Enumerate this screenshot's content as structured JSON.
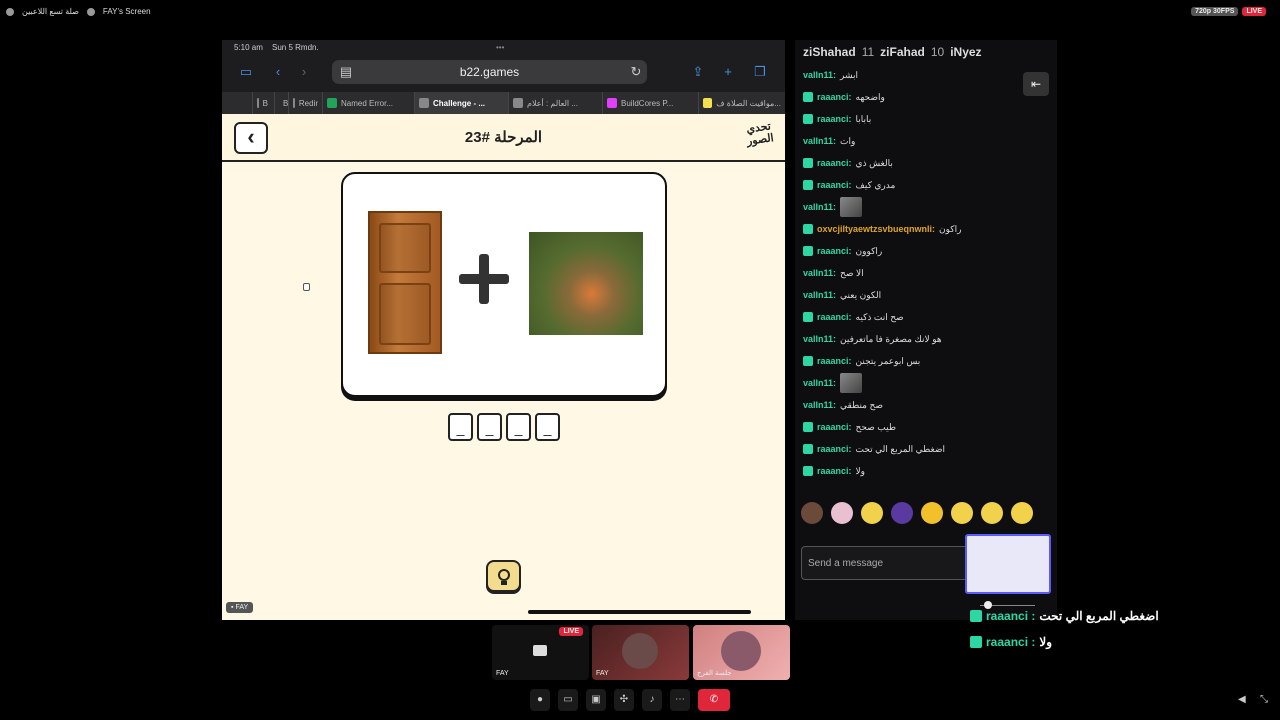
{
  "topbar": {
    "left_items": [
      "صلة تسع اللاعبين",
      "FAY's Screen"
    ],
    "quality": "720p 30FPS",
    "live": "LIVE"
  },
  "ipad": {
    "time": "5:10 am",
    "date": "Sun 5 Rmdn.",
    "url": "b22.games",
    "tabs": [
      {
        "label": "B",
        "color": "#888"
      },
      {
        "label": "B",
        "color": "#888"
      },
      {
        "label": "Redir",
        "color": "#888"
      },
      {
        "label": "Named Error...",
        "color": "#22a35a"
      },
      {
        "label": "Challenge - ...",
        "color": "#888"
      },
      {
        "label": "العالم : أعلام ...",
        "color": "#888"
      },
      {
        "label": "BuildCores P...",
        "color": "#e040fb"
      },
      {
        "label": "مواقيت الصلاة ف...",
        "color": "#f4e04d"
      }
    ],
    "level_title": "المرحلة #23",
    "logo_text": "تحدي الصور",
    "slots": [
      "_",
      "_",
      "_",
      "_"
    ],
    "fay_tag": "FAY"
  },
  "chat": {
    "viewers": [
      {
        "name": "ziShahad",
        "count": ""
      },
      {
        "name": "ziFahad",
        "count": "11"
      },
      {
        "name": "iNyez",
        "count": "10"
      }
    ],
    "messages": [
      {
        "user": "valln11:",
        "text": "ابشر",
        "color": "#2dd7a4",
        "badge": false
      },
      {
        "user": "raaanci:",
        "text": "واضحهه",
        "color": "#2dd7a4",
        "badge": true
      },
      {
        "user": "raaanci:",
        "text": "بابابا",
        "color": "#2dd7a4",
        "badge": true
      },
      {
        "user": "valln11:",
        "text": "وات",
        "color": "#2dd7a4",
        "badge": false
      },
      {
        "user": "raaanci:",
        "text": "بالغش ذي",
        "color": "#2dd7a4",
        "badge": true
      },
      {
        "user": "raaanci:",
        "text": "مدري كيف",
        "color": "#2dd7a4",
        "badge": true
      },
      {
        "user": "valln11:",
        "text": "",
        "color": "#2dd7a4",
        "badge": false,
        "thumb": true
      },
      {
        "user": "oxvcjiltyaewtzsvbueqnwnli:",
        "text": "راكون",
        "color": "#e0a520",
        "badge": true
      },
      {
        "user": "raaanci:",
        "text": "راكوون",
        "color": "#2dd7a4",
        "badge": true
      },
      {
        "user": "valln11:",
        "text": "الا صح",
        "color": "#2dd7a4",
        "badge": false
      },
      {
        "user": "valln11:",
        "text": "الكون يعني",
        "color": "#2dd7a4",
        "badge": false
      },
      {
        "user": "raaanci:",
        "text": "صح انت ذكيه",
        "color": "#2dd7a4",
        "badge": true
      },
      {
        "user": "valln11:",
        "text": "هو لانك مصغرة فا ماتعرفين",
        "color": "#2dd7a4",
        "badge": false
      },
      {
        "user": "raaanci:",
        "text": "بس ابوعمر يتجنن",
        "color": "#2dd7a4",
        "badge": true
      },
      {
        "user": "valln11:",
        "text": "",
        "color": "#2dd7a4",
        "badge": false,
        "thumb": true
      },
      {
        "user": "valln11:",
        "text": "صح منطقي",
        "color": "#2dd7a4",
        "badge": false
      },
      {
        "user": "raaanci:",
        "text": "طيب صحح",
        "color": "#2dd7a4",
        "badge": true
      },
      {
        "user": "raaanci:",
        "text": "اضغطي المربع الي تحت",
        "color": "#2dd7a4",
        "badge": true
      },
      {
        "user": "raaanci:",
        "text": "ولا",
        "color": "#2dd7a4",
        "badge": true
      }
    ],
    "emote_colors": [
      "#6b4a3a",
      "#e8c0d0",
      "#f2d24a",
      "#5a3aa0",
      "#f2c02a",
      "#f2d24a",
      "#f2d24a",
      "#f2d24a"
    ],
    "send_placeholder": "Send a message"
  },
  "overlay": [
    {
      "user": "raaanci :",
      "text": "اضغطي المربع الي تحت"
    },
    {
      "user": "raaanci :",
      "text": "ولا"
    }
  ],
  "tiles": [
    {
      "label": "FAY",
      "live": "LIVE"
    },
    {
      "label": "FAY"
    },
    {
      "label": "جلسة الفرج"
    }
  ]
}
